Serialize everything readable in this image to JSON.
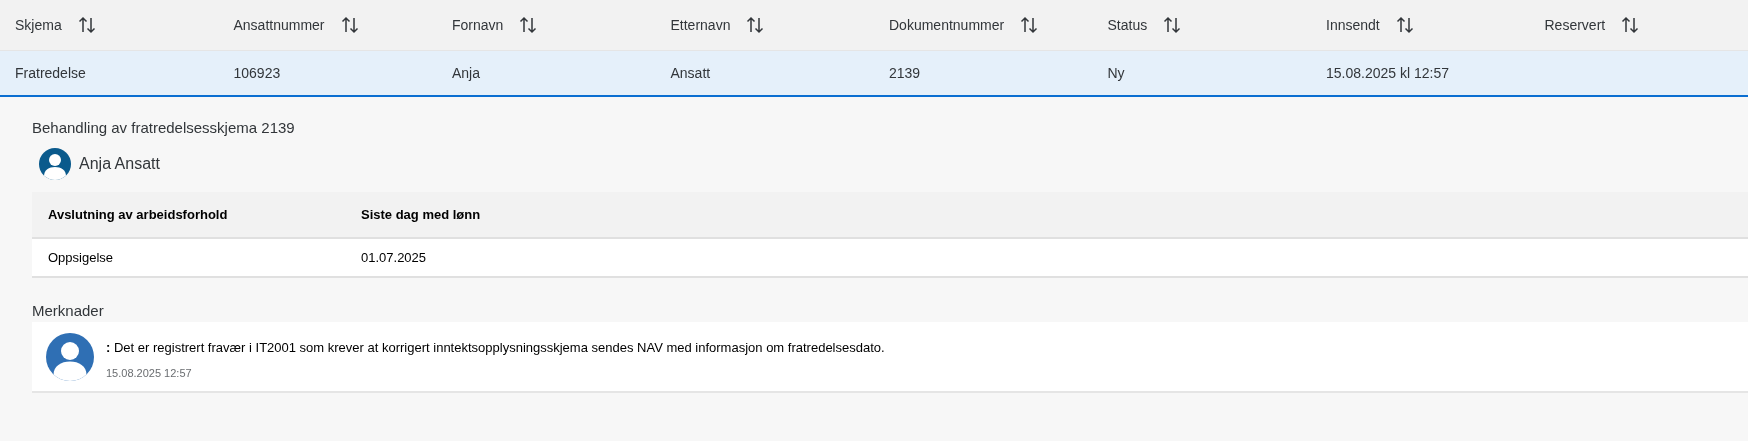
{
  "table": {
    "columns": [
      "Skjema",
      "Ansattnummer",
      "Fornavn",
      "Etternavn",
      "Dokumentnummer",
      "Status",
      "Innsendt",
      "Reservert"
    ],
    "rows": [
      {
        "selected": true,
        "cells": [
          "Fratredelse",
          "106923",
          "Anja",
          "Ansatt",
          "2139",
          "Ny",
          "15.08.2025 kl 12:57",
          ""
        ]
      }
    ]
  },
  "detail": {
    "title": "Behandling av fratredelsesskjema 2139",
    "person": "Anja Ansatt",
    "table": {
      "columns": [
        "Avslutning av arbeidsforhold",
        "Siste dag med lønn"
      ],
      "rows": [
        [
          "Oppsigelse",
          "01.07.2025"
        ]
      ]
    }
  },
  "remarks": {
    "title": "Merknader",
    "items": [
      {
        "author": ":",
        "text": "Det er registrert fravær i IT2001 som krever at korrigert inntektsopplysningsskjema sendes NAV med informasjon om fratredelsesdato.",
        "time": "15.08.2025 12:57"
      }
    ]
  }
}
